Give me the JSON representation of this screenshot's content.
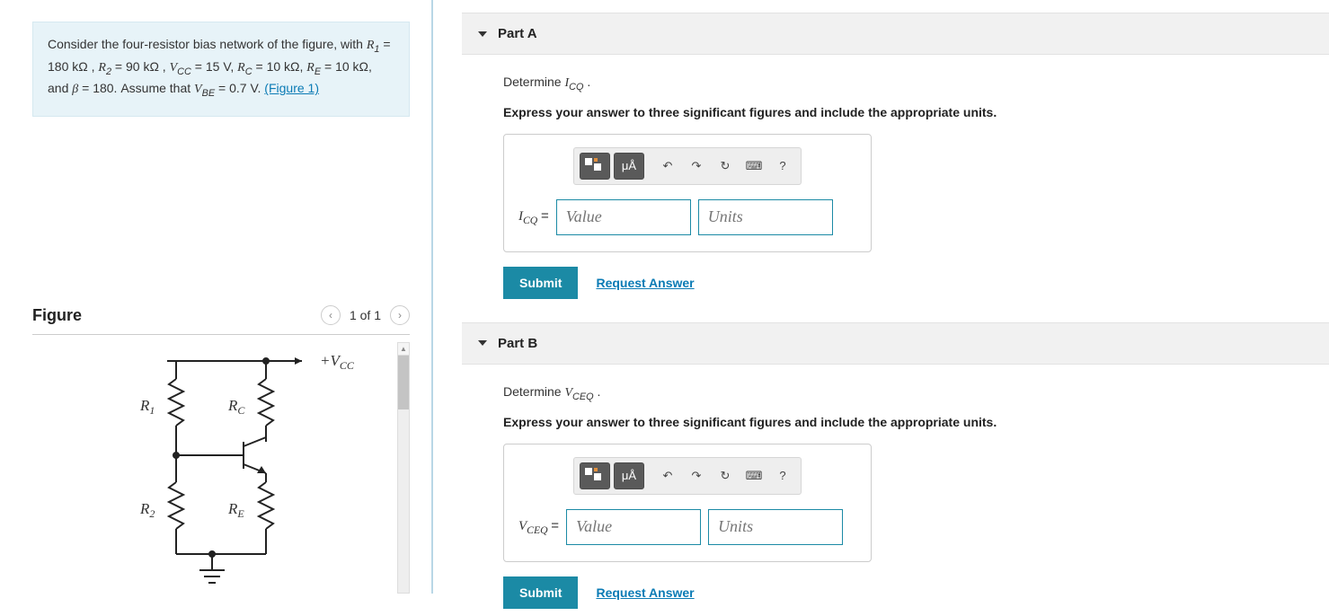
{
  "problem": {
    "text_prefix": "Consider the four-resistor bias network of the figure, with ",
    "R1_label": "R",
    "R1_sub": "1",
    "R1_eq": " = 180 kΩ , ",
    "R2_label": "R",
    "R2_sub": "2",
    "R2_eq": " = 90 kΩ , ",
    "Vcc_label": "V",
    "Vcc_sub": "CC",
    "Vcc_eq": " = 15 V, ",
    "Rc_label": "R",
    "Rc_sub": "C",
    "Rc_eq": " = 10 kΩ, ",
    "Re_label": "R",
    "Re_sub": "E",
    "Re_eq": " = 10 kΩ, and ",
    "beta_label": "β",
    "beta_eq": " = 180. Assume that ",
    "Vbe_label": "V",
    "Vbe_sub": "BE",
    "Vbe_eq": " = 0.7 V.",
    "figure_link": "(Figure 1)"
  },
  "figure": {
    "heading": "Figure",
    "counter": "1 of 1",
    "labels": {
      "Vcc": "+V",
      "Vcc_sub": "CC",
      "R1": "R",
      "R1_sub": "1",
      "R2": "R",
      "R2_sub": "2",
      "Rc": "R",
      "Rc_sub": "C",
      "Re": "R",
      "Re_sub": "E"
    }
  },
  "partA": {
    "title": "Part A",
    "prompt_pre": "Determine ",
    "prompt_var": "I",
    "prompt_sub": "CQ",
    "prompt_post": " .",
    "instr": "Express your answer to three significant figures and include the appropriate units.",
    "var": "I",
    "var_sub": "CQ",
    "value_ph": "Value",
    "units_ph": "Units",
    "submit": "Submit",
    "request": "Request Answer",
    "toolbar": {
      "units_glyph": "μÅ",
      "help": "?"
    }
  },
  "partB": {
    "title": "Part B",
    "prompt_pre": "Determine ",
    "prompt_var": "V",
    "prompt_sub": "CEQ",
    "prompt_post": " .",
    "instr": "Express your answer to three significant figures and include the appropriate units.",
    "var": "V",
    "var_sub": "CEQ",
    "value_ph": "Value",
    "units_ph": "Units",
    "submit": "Submit",
    "request": "Request Answer",
    "toolbar": {
      "units_glyph": "μÅ",
      "help": "?"
    }
  }
}
